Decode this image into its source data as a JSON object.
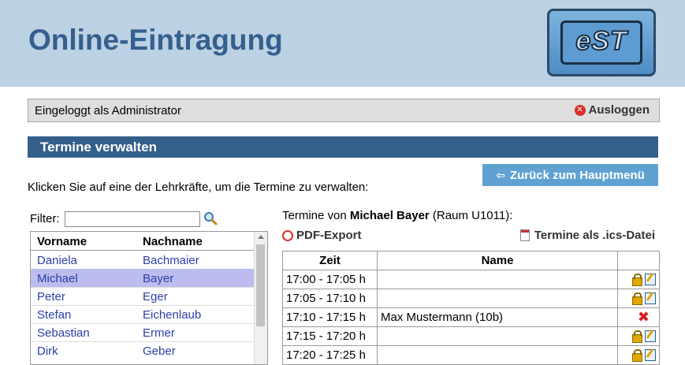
{
  "header": {
    "title": "Online-Eintragung",
    "logo_text": "eST"
  },
  "status": {
    "text": "Eingeloggt als Administrator",
    "logout_label": "Ausloggen"
  },
  "section": {
    "title": "Termine verwalten"
  },
  "back_button": {
    "label": "Zurück zum Hauptmenü"
  },
  "instruction": "Klicken Sie auf eine der Lehrkräfte, um die Termine zu verwalten:",
  "filter": {
    "label": "Filter:",
    "value": ""
  },
  "teacher_table": {
    "headers": [
      "Vorname",
      "Nachname"
    ],
    "rows": [
      [
        "Daniela",
        "Bachmaier"
      ],
      [
        "Michael",
        "Bayer"
      ],
      [
        "Peter",
        "Eger"
      ],
      [
        "Stefan",
        "Eichenlaub"
      ],
      [
        "Sebastian",
        "Ermer"
      ],
      [
        "Dirk",
        "Geber"
      ]
    ],
    "selected_index": 1
  },
  "appointments": {
    "prefix": "Termine von ",
    "teacher": "Michael Bayer",
    "room": " (Raum U1011):",
    "pdf_label": "PDF-Export",
    "ics_label": "Termine als .ics-Datei",
    "headers": [
      "Zeit",
      "Name"
    ],
    "rows": [
      [
        "17:00 - 17:05 h",
        ""
      ],
      [
        "17:05 - 17:10 h",
        ""
      ],
      [
        "17:10 - 17:15 h",
        "Max Mustermann (10b)"
      ],
      [
        "17:15 - 17:20 h",
        ""
      ],
      [
        "17:20 - 17:25 h",
        ""
      ]
    ]
  },
  "colors": {
    "header_bg": "#bcd1e3",
    "title": "#355f8e",
    "section_bar": "#345f8b",
    "button": "#5fa2d2",
    "selected_row": "#bcbcee",
    "link": "#2b3fa8"
  }
}
